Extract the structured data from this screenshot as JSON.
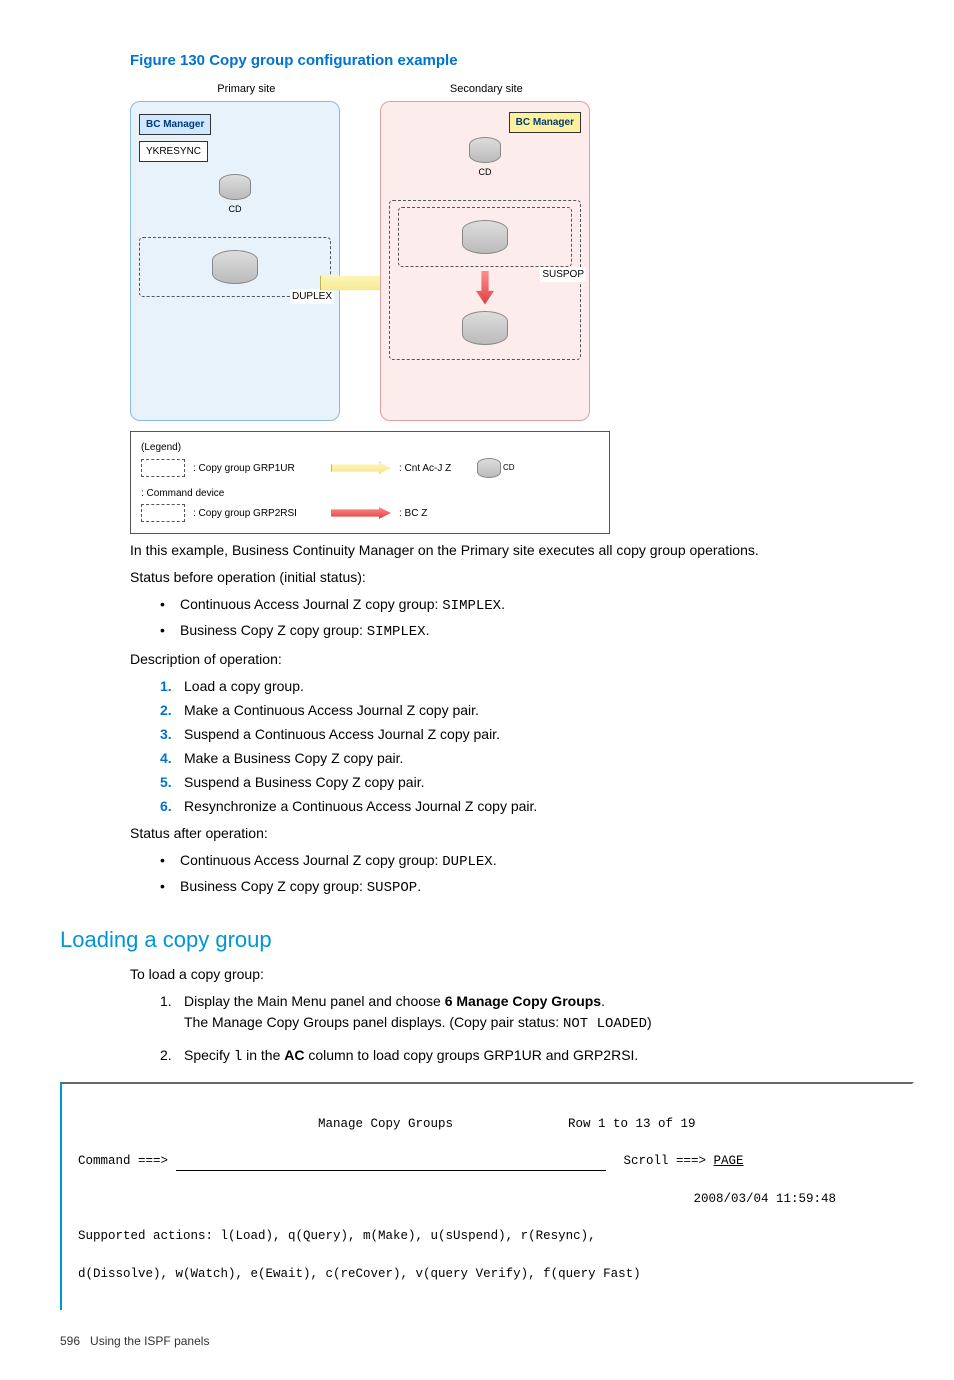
{
  "figure": {
    "title": "Figure 130 Copy group configuration example",
    "primary_label": "Primary site",
    "secondary_label": "Secondary site",
    "bc_manager": "BC Manager",
    "ykresync": "YKRESYNC",
    "cd": "CD",
    "duplex": "DUPLEX",
    "suspop": "SUSPOP"
  },
  "legend": {
    "title": "(Legend)",
    "grp1": ": Copy group GRP1UR",
    "grp2": ": Copy group GRP2RSI",
    "cnt": ": Cnt Ac-J Z",
    "bcz": ": BC Z",
    "cmddev": ": Command device",
    "cd": "CD"
  },
  "para1": "In this example, Business Continuity Manager on the Primary site executes all copy group operations.",
  "para2": "Status before operation (initial status):",
  "bullets1": {
    "a_pre": "Continuous Access Journal Z copy group: ",
    "a_code": "SIMPLEX",
    "b_pre": "Business Copy Z copy group: ",
    "b_code": "SIMPLEX"
  },
  "para3": "Description of operation:",
  "steps": {
    "s1": "Load a copy group.",
    "s2": "Make a Continuous Access Journal Z copy pair.",
    "s3": "Suspend a Continuous Access Journal Z copy pair.",
    "s4": "Make a Business Copy Z copy pair.",
    "s5": "Suspend a Business Copy Z copy pair.",
    "s6": "Resynchronize a Continuous Access Journal Z copy pair."
  },
  "para4": "Status after operation:",
  "bullets2": {
    "a_pre": "Continuous Access Journal Z copy group: ",
    "a_code": "DUPLEX",
    "b_pre": "Business Copy Z copy group: ",
    "b_code": "SUSPOP"
  },
  "section_heading": "Loading a copy group",
  "para5": "To load a copy group:",
  "loadsteps": {
    "s1_pre": "Display the Main Menu panel and choose ",
    "s1_bold": "6 Manage Copy Groups",
    "s1_post": ".",
    "s1_line2_pre": "The Manage Copy Groups panel displays. (Copy pair status: ",
    "s1_line2_code": "NOT LOADED",
    "s1_line2_post": ")",
    "s2_pre": "Specify ",
    "s2_code": "l",
    "s2_mid": " in the ",
    "s2_bold": "AC",
    "s2_post": " column to load copy groups GRP1UR and GRP2RSI."
  },
  "terminal": {
    "title": "Manage Copy Groups",
    "row_info": "Row 1 to 13 of 19",
    "command_label": "Command ===> ",
    "scroll_label": "Scroll ===> ",
    "scroll_value": "PAGE",
    "timestamp": "2008/03/04 11:59:48",
    "supported1": "Supported actions: l(Load), q(Query), m(Make), u(sUspend), r(Resync),",
    "supported2": "d(Dissolve), w(Watch), e(Ewait), c(reCover), v(query Verify), f(query Fast)"
  },
  "footer": {
    "page": "596",
    "chapter": "Using the ISPF panels"
  },
  "periods": {
    "p": "."
  }
}
